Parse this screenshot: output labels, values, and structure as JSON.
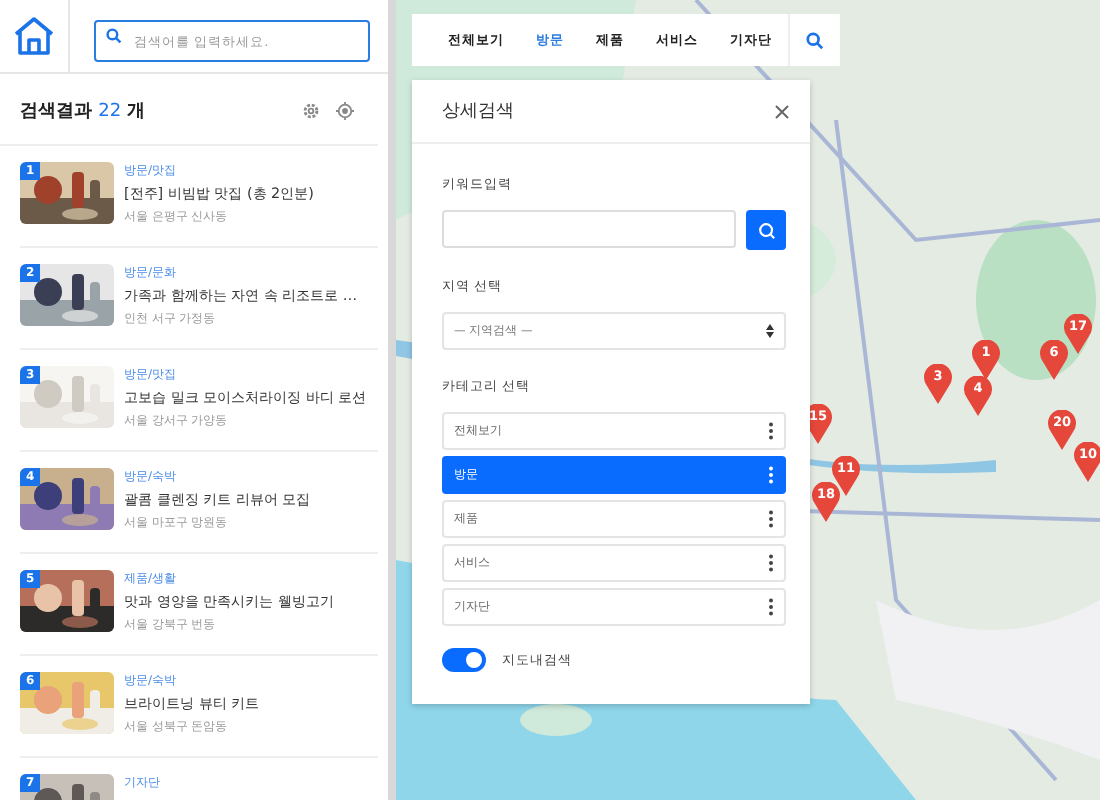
{
  "header": {
    "search": {
      "placeholder": "검색어를 입력하세요."
    }
  },
  "results": {
    "label": "검색결과",
    "count": "22",
    "unit": "개"
  },
  "items": [
    {
      "number": "1",
      "category": "방문/맛집",
      "title": "[전주] 비빔밥 맛집 (총 2인분)",
      "location": "서울 은평구 신사동",
      "kind": "picture"
    },
    {
      "number": "2",
      "category": "방문/문화",
      "title": "가족과 함께하는 자연 속 리조트로 …",
      "location": "인천 서구 가정동",
      "kind": "picture"
    },
    {
      "number": "3",
      "category": "방문/맛집",
      "title": "고보습 밀크 모이스처라이징 바디 로션",
      "location": "서울 강서구 가양동",
      "kind": "picture"
    },
    {
      "number": "4",
      "category": "방문/숙박",
      "title": "괄콤 클렌징 키트 리뷰어 모집",
      "location": "서울 마포구 망원동",
      "kind": "picture"
    },
    {
      "number": "5",
      "category": "제품/생활",
      "title": "맛과 영양을 만족시키는 웰빙고기",
      "location": "서울 강북구 번동",
      "kind": "picture"
    },
    {
      "number": "6",
      "category": "방문/숙박",
      "title": "브라이트닝 뷰티 키트",
      "location": "서울 성북구 돈암동",
      "kind": "picture"
    },
    {
      "number": "7",
      "category": "기자단",
      "kind": "picture"
    }
  ],
  "tabs": [
    {
      "label": "전체보기",
      "selected": false
    },
    {
      "label": "방문",
      "selected": true
    },
    {
      "label": "제품",
      "selected": false
    },
    {
      "label": "서비스",
      "selected": false
    },
    {
      "label": "기자단",
      "selected": false
    }
  ],
  "panel": {
    "title": "상세검색",
    "keyword_label": "키워드입력",
    "region_label": "지역 선택",
    "region_select": "— 지역검색 —",
    "category_label": "카테고리 선택",
    "categories": [
      {
        "label": "전체보기",
        "selected": false
      },
      {
        "label": "방문",
        "selected": true
      },
      {
        "label": "제품",
        "selected": false
      },
      {
        "label": "서비스",
        "selected": false
      },
      {
        "label": "기자단",
        "selected": false
      }
    ],
    "map_search": {
      "label": "지도내검색",
      "on": true
    }
  },
  "markers": [
    {
      "label": "17"
    },
    {
      "label": "1"
    },
    {
      "label": "6"
    },
    {
      "label": "3"
    },
    {
      "label": "4"
    },
    {
      "label": "15"
    },
    {
      "label": "20"
    },
    {
      "label": "10"
    },
    {
      "label": "11"
    },
    {
      "label": "18"
    }
  ]
}
